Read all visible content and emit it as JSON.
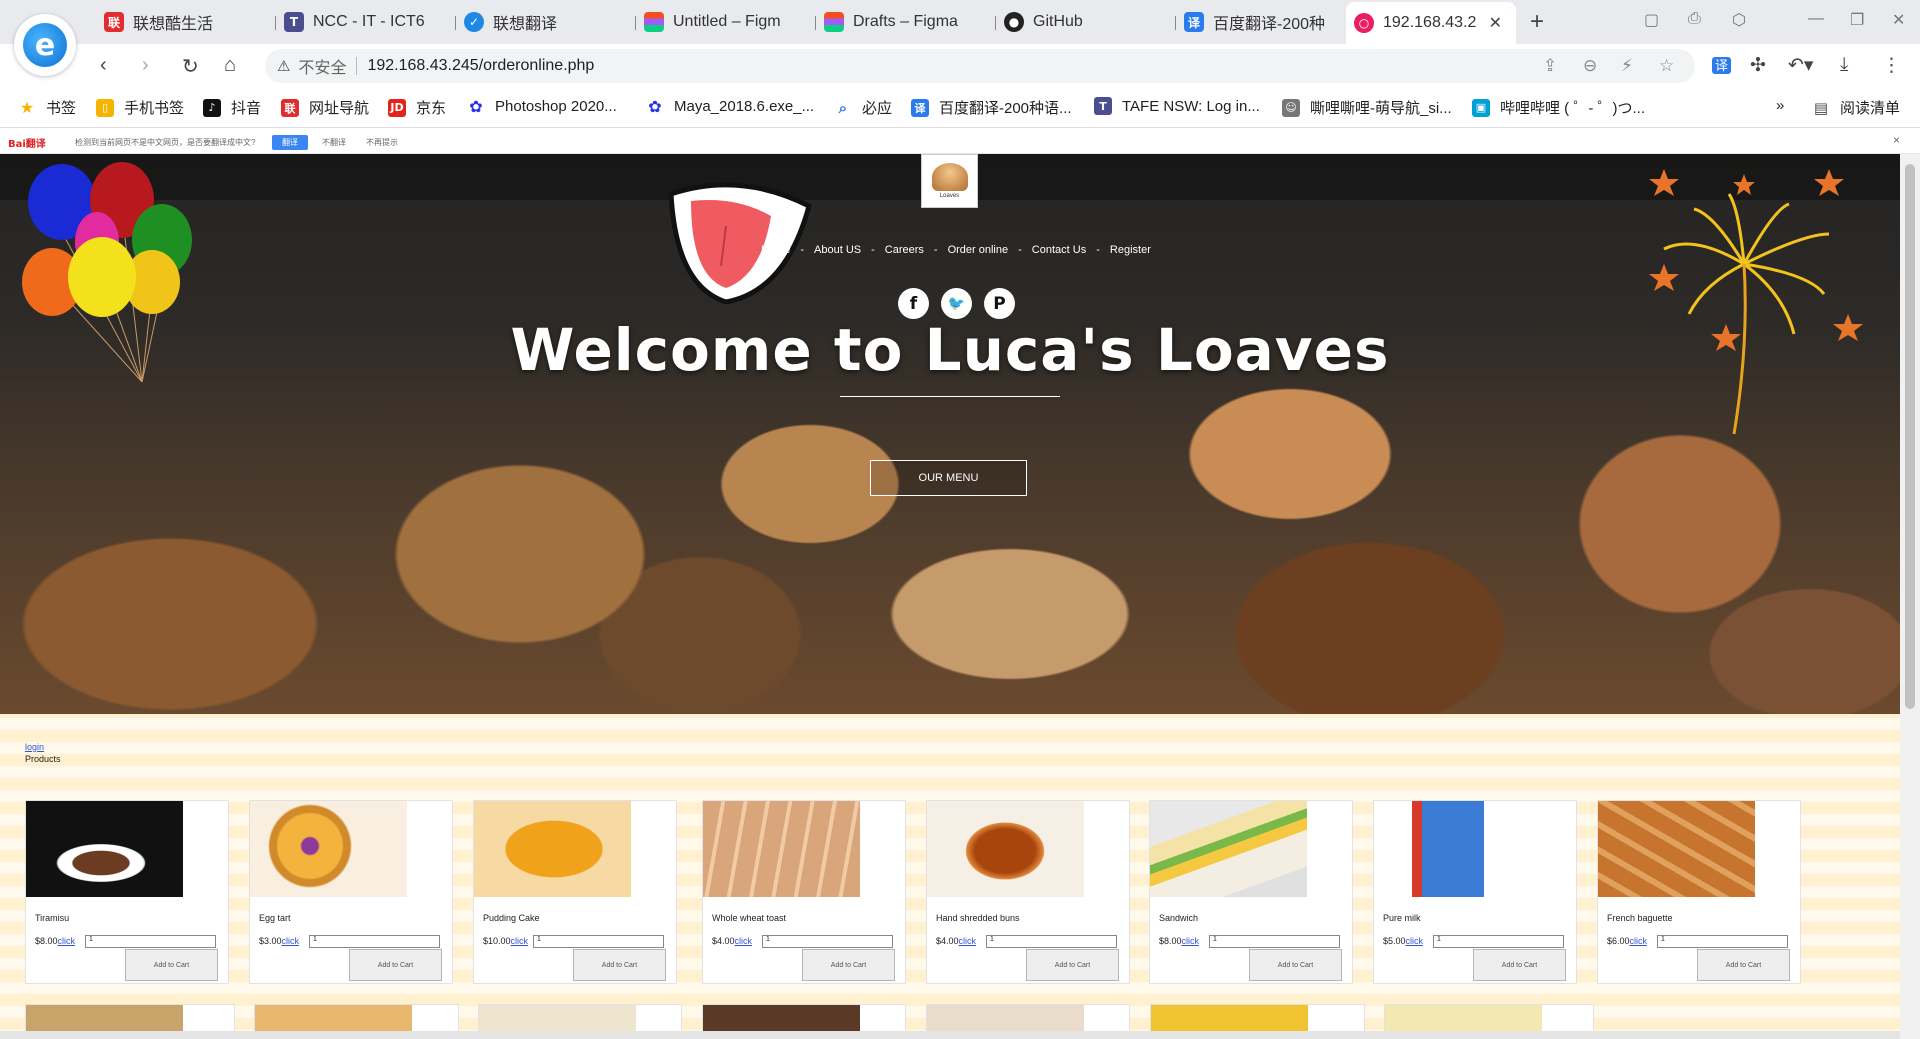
{
  "browser": {
    "tabs": [
      {
        "title": "联想酷生活",
        "icon": "lenovo-icon",
        "color": "#e02e2e"
      },
      {
        "title": "NCC - IT - ICT6",
        "icon": "t-icon",
        "color": "#4a4e8c"
      },
      {
        "title": "联想翻译",
        "icon": "translate-bird-icon",
        "color": "#1e88e5"
      },
      {
        "title": "Untitled – Figm",
        "icon": "figma-icon",
        "color": "#f24e1e"
      },
      {
        "title": "Drafts – Figma",
        "icon": "figma-icon",
        "color": "#f24e1e"
      },
      {
        "title": "GitHub",
        "icon": "github-icon",
        "color": "#222222"
      },
      {
        "title": "百度翻译-200种",
        "icon": "baidu-translate-icon",
        "color": "#2b7bea"
      },
      {
        "title": "192.168.43.2",
        "icon": "page-icon",
        "color": "#e91e63"
      }
    ],
    "address": {
      "security": "不安全",
      "url": "192.168.43.245/orderonline.php"
    },
    "bookmarks": [
      {
        "label": "书签",
        "icon": "star-icon",
        "color": "#f5b400"
      },
      {
        "label": "手机书签",
        "icon": "phone-icon",
        "color": "#f5b400"
      },
      {
        "label": "抖音",
        "icon": "tiktok-icon",
        "color": "#111111"
      },
      {
        "label": "网址导航",
        "icon": "lenovo-icon",
        "color": "#e02e2e"
      },
      {
        "label": "京东",
        "icon": "jd-icon",
        "color": "#e1251b"
      },
      {
        "label": "Photoshop 2020...",
        "icon": "baidu-paw-icon",
        "color": "#2932e1"
      },
      {
        "label": "Maya_2018.6.exe_...",
        "icon": "baidu-paw-icon",
        "color": "#2932e1"
      },
      {
        "label": "必应",
        "icon": "search-icon",
        "color": "#2b7bea"
      },
      {
        "label": "百度翻译-200种语...",
        "icon": "baidu-translate-icon",
        "color": "#2b7bea"
      },
      {
        "label": "TAFE NSW: Log in...",
        "icon": "t-icon",
        "color": "#4a4e8c"
      },
      {
        "label": "嘶哩嘶哩-萌导航_si...",
        "icon": "anime-icon",
        "color": "#777777"
      },
      {
        "label": "哔哩哔哩 ( ゜- ゜)つ...",
        "icon": "bilibili-icon",
        "color": "#00a1d6"
      }
    ],
    "reading_list": "阅读清单",
    "more_bookmarks": "»",
    "translate_bar": {
      "brand": "Bai翻译",
      "message": "检测到当前网页不是中文网页，是否要翻译成中文?",
      "translate": "翻译",
      "dont_translate": "不翻译",
      "never": "不再提示"
    }
  },
  "site": {
    "logo_text": "Loaves",
    "nav": [
      "Home",
      "About US",
      "Careers",
      "Order online",
      "Contact Us",
      "Register"
    ],
    "social": [
      {
        "name": "facebook-icon",
        "glyph": "f"
      },
      {
        "name": "twitter-icon",
        "glyph": "t"
      },
      {
        "name": "pinterest-icon",
        "glyph": "p"
      }
    ],
    "hero_title": "Welcome to Luca's Loaves",
    "menu_button": "OUR MENU",
    "login_link": "login",
    "products_label": "Products",
    "add_to_cart": "Add to Cart",
    "click_label": "click",
    "products": [
      {
        "name": "Tiramisu",
        "price": "$8.00",
        "qty": "1"
      },
      {
        "name": "Egg tart",
        "price": "$3.00",
        "qty": "1"
      },
      {
        "name": "Pudding Cake",
        "price": "$10.00",
        "qty": "1"
      },
      {
        "name": "Whole wheat toast",
        "price": "$4.00",
        "qty": "1"
      },
      {
        "name": "Hand shredded buns",
        "price": "$4.00",
        "qty": "1"
      },
      {
        "name": "Sandwich",
        "price": "$8.00",
        "qty": "1"
      },
      {
        "name": "Pure milk",
        "price": "$5.00",
        "qty": "1"
      },
      {
        "name": "French baguette",
        "price": "$6.00",
        "qty": "1"
      }
    ]
  }
}
